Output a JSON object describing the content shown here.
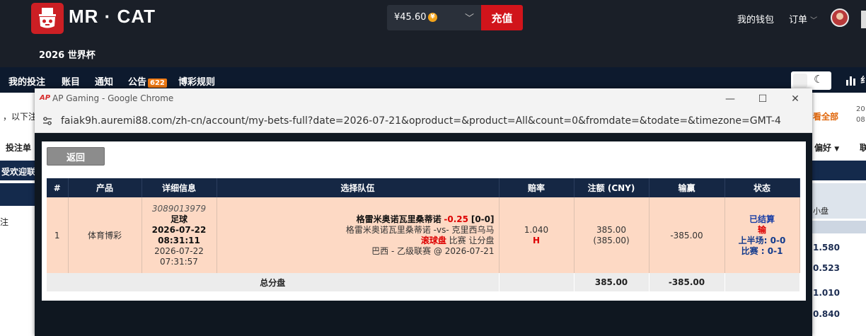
{
  "site": {
    "brand": "MR · CAT",
    "sub_brand": "2026 世界杯",
    "balance": "¥45.60",
    "recharge": "充值",
    "wallet": "我的钱包",
    "orders": "订单",
    "nav": [
      "我的投注",
      "账目",
      "通知",
      "公告",
      "博彩规则"
    ],
    "notice_badge": "622",
    "left_fragments": [
      "，以下注",
      "投注单",
      "受欢迎联",
      "注"
    ],
    "right_fragments": [
      "看全部",
      "20",
      "08",
      "偏好",
      "联",
      "小盘",
      "1.580",
      "0.523",
      "1.010",
      "0.840",
      "纟"
    ]
  },
  "chrome": {
    "title": "AP Gaming - Google Chrome",
    "ap_logo": "AP",
    "url": "faiak9h.auremi88.com/zh-cn/account/my-bets-full?date=2026-07-21&oproduct=&product=All&count=0&fromdate=&todate=&timezone=GMT-4"
  },
  "page": {
    "back": "返回",
    "headers": [
      "#",
      "产品",
      "详细信息",
      "选择队伍",
      "赔率",
      "注额 (CNY)",
      "输赢",
      "状态"
    ],
    "bet": {
      "index": "1",
      "product": "体育博彩",
      "ticket_id": "3089013979",
      "sport": "足球",
      "bet_date": "2026-07-22",
      "bet_time": "08:31:11",
      "local_date": "2026-07-22",
      "local_time": "07:31:57",
      "pick_team": "格雷米奥诺瓦里桑蒂诺",
      "pick_hdp": "-0.25",
      "pick_score": "[0-0]",
      "match": "格雷米奥诺瓦里桑蒂诺 -vs- 克里西乌马",
      "market_live": "滚球盘",
      "market_type": "比赛 让分盘",
      "league": "巴西 - 乙级联赛 @ 2026-07-21",
      "odds": "1.040",
      "odds_type": "H",
      "stake": "385.00",
      "stake_sub": "(385.00)",
      "winloss": "-385.00",
      "status": "已结算",
      "result": "输",
      "half_score": "上半场: 0-0",
      "full_score": "比赛 : 0-1"
    },
    "total": {
      "label": "总分盘",
      "stake": "385.00",
      "winloss": "-385.00"
    }
  }
}
